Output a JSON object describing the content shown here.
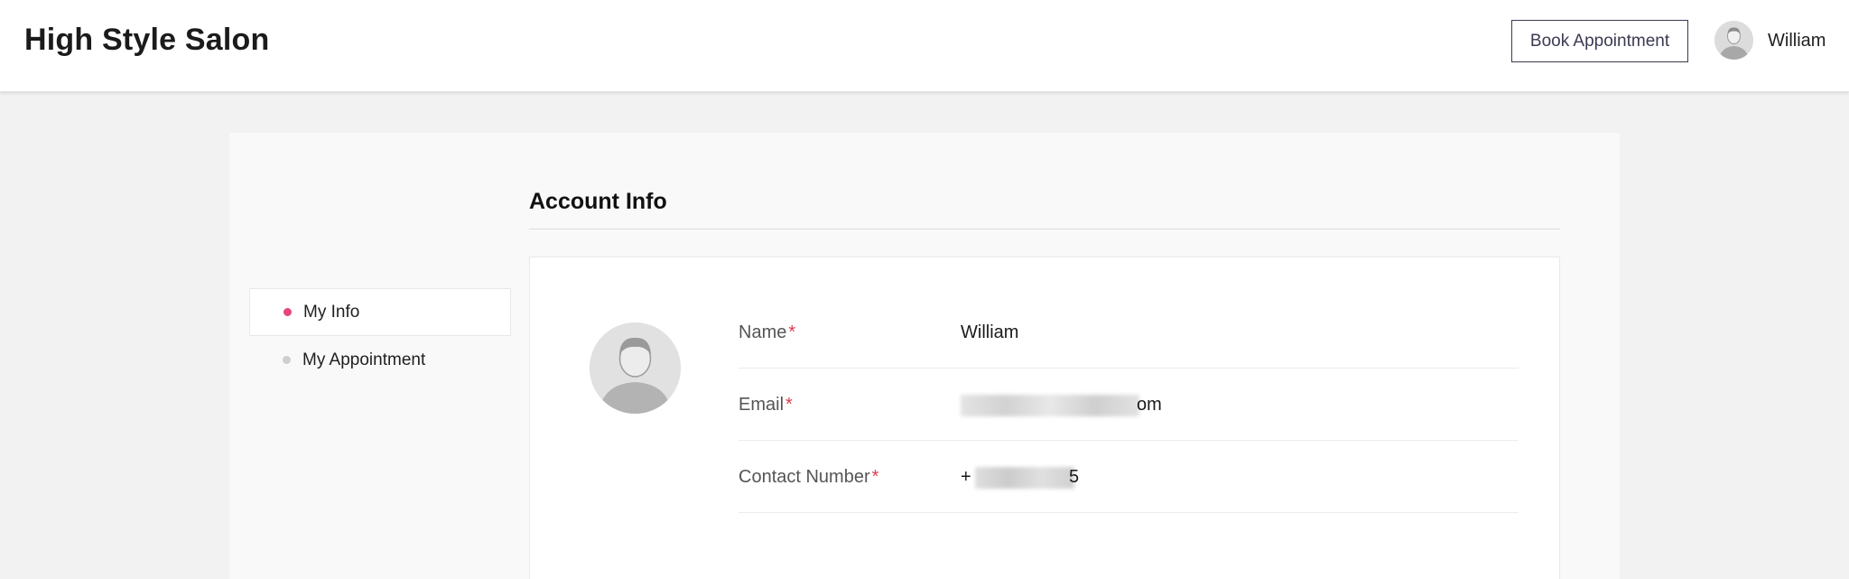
{
  "header": {
    "brand": "High Style Salon",
    "book_label": "Book Appointment",
    "user_name": "William",
    "avatar_icon": "user-avatar-icon"
  },
  "account": {
    "title": "Account Info"
  },
  "sidebar": {
    "items": [
      {
        "label": "My Info",
        "active": true,
        "dot_color": "#e8457a"
      },
      {
        "label": "My Appointment",
        "active": false,
        "dot_color": "#cfcfcf"
      }
    ]
  },
  "profile": {
    "avatar_icon": "profile-avatar-icon",
    "fields": [
      {
        "label": "Name",
        "required_mark": "*",
        "value": "William"
      },
      {
        "label": "Email",
        "required_mark": "*",
        "value_visible_tail": "om"
      },
      {
        "label": "Contact Number",
        "required_mark": "*",
        "value_visible_prefix": "+",
        "value_visible_tail": "5"
      }
    ]
  },
  "colors": {
    "accent": "#e8457a",
    "required": "#e03a4e",
    "button_border": "#3a3a52"
  }
}
